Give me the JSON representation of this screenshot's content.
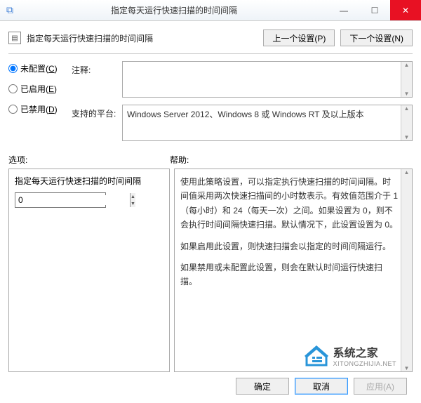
{
  "window": {
    "title": "指定每天运行快速扫描的时间间隔",
    "subtitle": "指定每天运行快速扫描的时间间隔"
  },
  "nav": {
    "prev": "上一个设置(P)",
    "next": "下一个设置(N)"
  },
  "radios": {
    "not_configured": "未配置(C)",
    "enabled": "已启用(E)",
    "disabled": "已禁用(D)"
  },
  "fields": {
    "comment_label": "注释:",
    "platform_label": "支持的平台:",
    "platform_value": "Windows Server 2012、Windows 8 或 Windows RT 及以上版本"
  },
  "sections": {
    "options_label": "选项:",
    "help_label": "帮助:"
  },
  "options": {
    "interval_label": "指定每天运行快速扫描的时间间隔",
    "interval_value": "0"
  },
  "help": {
    "p1": "使用此策略设置，可以指定执行快速扫描的时间间隔。时间值采用两次快速扫描间的小时数表示。有效值范围介于 1（每小时）和 24（每天一次）之间。如果设置为 0，则不会执行时间间隔快速扫描。默认情况下，此设置设置为 0。",
    "p2": "如果启用此设置，则快速扫描会以指定的时间间隔运行。",
    "p3": "如果禁用或未配置此设置，则会在默认时间运行快速扫描。"
  },
  "footer": {
    "ok": "确定",
    "cancel": "取消",
    "apply": "应用(A)"
  },
  "watermark": {
    "name": "系统之家",
    "url": "XITONGZHIJIA.NET"
  }
}
